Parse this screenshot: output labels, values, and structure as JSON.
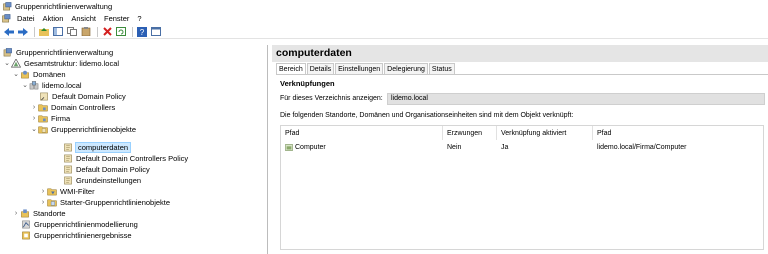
{
  "window": {
    "title": "Gruppenrichtlinienverwaltung"
  },
  "menu": {
    "items": [
      "Datei",
      "Aktion",
      "Ansicht",
      "Fenster",
      "?"
    ]
  },
  "toolbar": {
    "buttons": [
      "back-icon",
      "forward-icon",
      "up-folder-icon",
      "show-hide-tree-icon",
      "copy-icon",
      "paste-icon",
      "delete-icon",
      "refresh-icon",
      "help-icon",
      "properties-icon"
    ]
  },
  "tree": {
    "root": "Gruppenrichtlinienverwaltung",
    "forest": "Gesamtstruktur: lidemo.local",
    "domains": "Domänen",
    "domain": "lidemo.local",
    "default_domain_policy": "Default Domain Policy",
    "domain_controllers": "Domain Controllers",
    "firma": "Firma",
    "gpo_folder": "Gruppenrichtlinienobjekte",
    "gpo_computerdaten": "computerdaten",
    "gpo_ddcp": "Default Domain Controllers Policy",
    "gpo_ddp": "Default Domain Policy",
    "gpo_grund": "Grundeinstellungen",
    "wmi": "WMI-Filter",
    "starter": "Starter-Gruppenrichtlinienobjekte",
    "sites": "Standorte",
    "modeling": "Gruppenrichtlinienmodellierung",
    "results": "Gruppenrichtlinienergebnisse"
  },
  "detail": {
    "title": "computerdaten",
    "tabs": [
      "Bereich",
      "Details",
      "Einstellungen",
      "Delegierung",
      "Status"
    ],
    "section_title": "Verknüpfungen",
    "dir_label": "Für dieses Verzeichnis anzeigen:",
    "dir_value": "lidemo.local",
    "description": "Die folgenden Standorte, Domänen und Organisationseinheiten sind mit dem Objekt verknüpft:",
    "columns": [
      "Pfad",
      "Erzwungen",
      "Verknüpfung aktiviert",
      "Pfad"
    ],
    "rows": [
      {
        "name": "Computer",
        "enforced": "Nein",
        "enabled": "Ja",
        "path": "lidemo.local/Firma/Computer"
      }
    ]
  }
}
